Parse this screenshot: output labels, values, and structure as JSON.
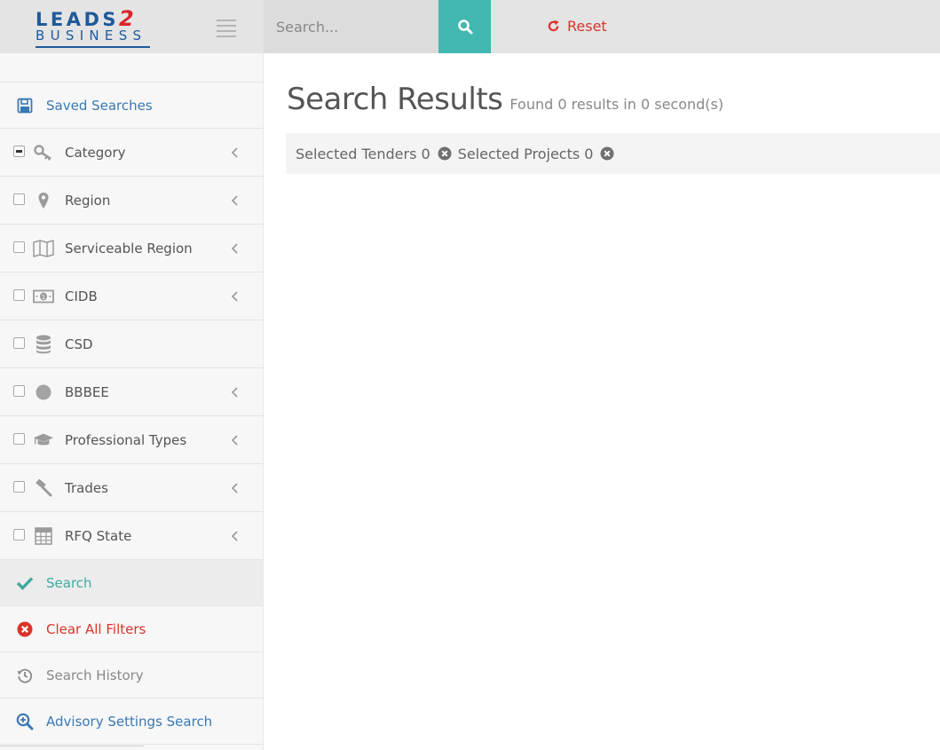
{
  "brand": {
    "logo_top": "LEADS",
    "logo_two": "2",
    "logo_bottom": "BUSINESS"
  },
  "header": {
    "search_placeholder": "Search...",
    "reset_label": "Reset"
  },
  "sidebar": {
    "saved_searches": "Saved Searches",
    "filters": [
      {
        "label": "Category",
        "icon": "key-icon",
        "checkbox": "indeterminate",
        "has_chevron": true
      },
      {
        "label": "Region",
        "icon": "map-marker-icon",
        "checkbox": "unchecked",
        "has_chevron": true
      },
      {
        "label": "Serviceable Region",
        "icon": "map-icon",
        "checkbox": "unchecked",
        "has_chevron": true
      },
      {
        "label": "CIDB",
        "icon": "money-icon",
        "checkbox": "unchecked",
        "has_chevron": true
      },
      {
        "label": "CSD",
        "icon": "database-icon",
        "checkbox": "unchecked",
        "has_chevron": false
      },
      {
        "label": "BBBEE",
        "icon": "circle-icon",
        "checkbox": "unchecked",
        "has_chevron": true
      },
      {
        "label": "Professional Types",
        "icon": "graduation-cap-icon",
        "checkbox": "unchecked",
        "has_chevron": true
      },
      {
        "label": "Trades",
        "icon": "gavel-icon",
        "checkbox": "unchecked",
        "has_chevron": true
      },
      {
        "label": "RFQ State",
        "icon": "calculator-icon",
        "checkbox": "unchecked",
        "has_chevron": true
      }
    ],
    "search": "Search",
    "clear_all": "Clear All Filters",
    "history": "Search History",
    "advisory": "Advisory Settings Search"
  },
  "main": {
    "title": "Search Results",
    "subtitle": "Found 0 results in 0 second(s)",
    "selected_tenders": "Selected Tenders 0",
    "selected_projects": "Selected Projects 0"
  },
  "colors": {
    "teal": "#42b8b0",
    "blue": "#3a78b5",
    "red": "#d9342b",
    "logo_blue": "#1d5a9a",
    "logo_red": "#d9262b"
  }
}
